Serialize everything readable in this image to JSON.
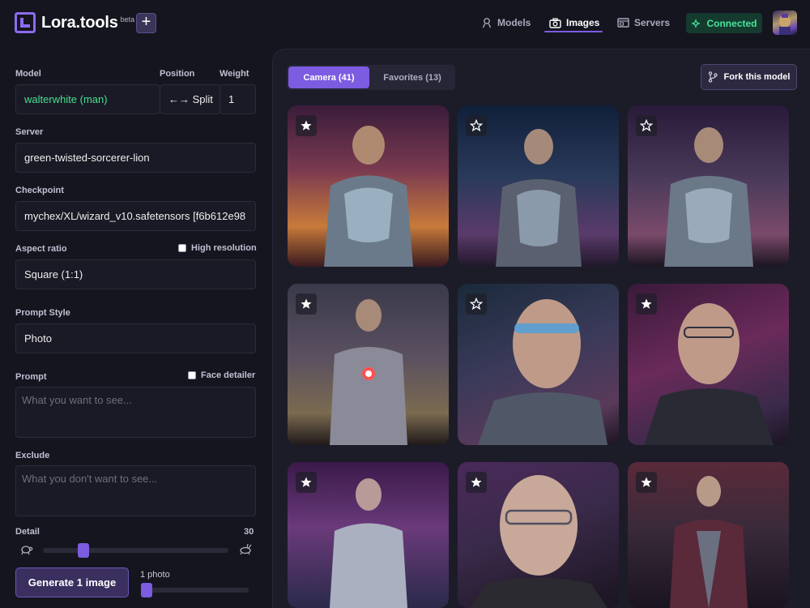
{
  "app": {
    "name": "Lora.tools",
    "badge": "beta",
    "new_label": "+"
  },
  "nav": [
    {
      "label": "Models",
      "icon": "models-icon"
    },
    {
      "label": "Images",
      "icon": "camera-icon",
      "active": true
    },
    {
      "label": "Servers",
      "icon": "server-icon"
    }
  ],
  "status": {
    "label": "Connected",
    "color": "#45e59b"
  },
  "form": {
    "model_label": "Model",
    "model_value": "walterwhite (man)",
    "position_label": "Position",
    "position_value": "←→ Split",
    "weight_label": "Weight",
    "weight_value": "1",
    "server_label": "Server",
    "server_value": "green-twisted-sorcerer-lion",
    "checkpoint_label": "Checkpoint",
    "checkpoint_value": "mychex/XL/wizard_v10.safetensors [f6b612e98",
    "aspect_label": "Aspect ratio",
    "high_res_label": "High resolution",
    "aspect_value": "Square (1:1)",
    "prompt_style_label": "Prompt Style",
    "prompt_style_value": "Photo",
    "prompt_label": "Prompt",
    "face_detailer_label": "Face detailer",
    "prompt_placeholder": "What you want to see...",
    "exclude_label": "Exclude",
    "exclude_placeholder": "What you don't want to see...",
    "detail_label": "Detail",
    "detail_value": "30",
    "detail_level": 0.2,
    "generate_label": "Generate 1 image",
    "photos_label": "1 photo",
    "photos_level": 0.0
  },
  "gallery": {
    "tabs": [
      {
        "label": "Camera (41)",
        "active": true
      },
      {
        "label": "Favorites (13)"
      }
    ],
    "fork_label": "Fork this model",
    "accent": "#7c5ce0"
  }
}
